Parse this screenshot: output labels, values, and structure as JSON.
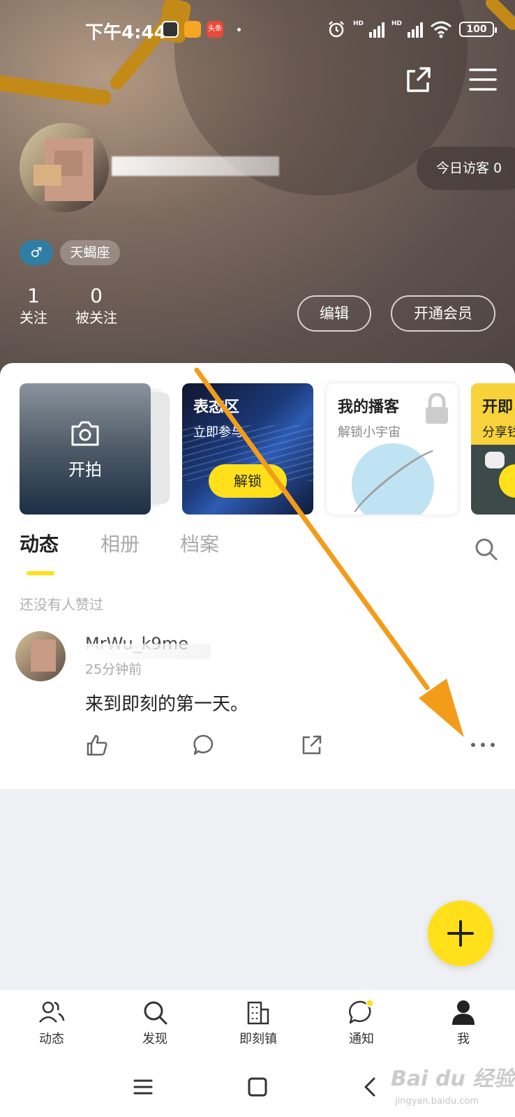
{
  "status_bar": {
    "time": "下午4:44",
    "app_icon_label": "头条",
    "battery": "100",
    "hd1": "HD",
    "hd2": "HD"
  },
  "header": {
    "visitors_label": "今日访客 0",
    "gender_symbol": "♂",
    "zodiac": "天蝎座",
    "following_count": "1",
    "following_label": "关注",
    "followers_count": "0",
    "followers_label": "被关注",
    "edit_label": "编辑",
    "vip_label": "开通会员"
  },
  "cards": {
    "shoot_label": "开拍",
    "biaotai_title": "表态区",
    "biaotai_sub": "立即参与",
    "biaotai_btn": "解锁",
    "podcast_title": "我的播客",
    "podcast_sub": "解锁小宇宙",
    "live_title": "开即",
    "live_sub": "分享钱"
  },
  "tabs": [
    "动态",
    "相册",
    "档案"
  ],
  "feed": {
    "no_likes": "还没有人赞过",
    "post": {
      "user": "MrWu_k9me",
      "time": "25分钟前",
      "text": "来到即刻的第一天。"
    }
  },
  "bottom_nav": [
    {
      "label": "动态",
      "icon": "people-icon"
    },
    {
      "label": "发现",
      "icon": "search-icon"
    },
    {
      "label": "即刻镇",
      "icon": "building-icon"
    },
    {
      "label": "通知",
      "icon": "chat-bubble-icon"
    },
    {
      "label": "我",
      "icon": "person-icon"
    }
  ],
  "watermark": {
    "main": "Bai du 经验",
    "sub": "jingyan.baidu.com"
  },
  "colors": {
    "accent": "#ffe01b",
    "gender_tag": "#2f7fa5",
    "annotation_arrow": "#f39c1a"
  }
}
